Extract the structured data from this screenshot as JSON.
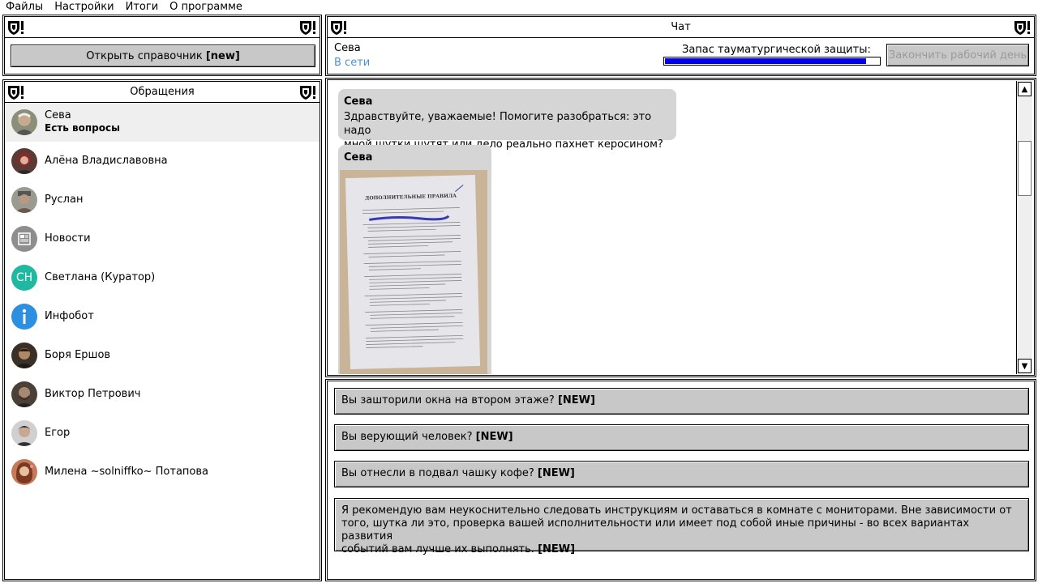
{
  "menu": [
    "Файлы",
    "Настройки",
    "Итоги",
    "О программе"
  ],
  "left_top": {
    "open_ref_label": "Открыть справочник",
    "open_ref_badge": "[new]"
  },
  "contacts_panel": {
    "title": "Обращения",
    "contacts": [
      {
        "name": "Сева",
        "status": "Есть вопросы",
        "avatar": "photo-avatar-old-man"
      },
      {
        "name": "Алёна Владиславовна",
        "status": "",
        "avatar": "photo-avatar-woman-red"
      },
      {
        "name": "Руслан",
        "status": "",
        "avatar": "photo-avatar-man-cap"
      },
      {
        "name": "Новости",
        "status": "",
        "avatar": "newspaper-icon"
      },
      {
        "name": "Светлана (Куратор)",
        "status": "",
        "avatar": "initials-СН"
      },
      {
        "name": "Инфобот",
        "status": "",
        "avatar": "info-icon"
      },
      {
        "name": "Боря Ершов",
        "status": "",
        "avatar": "photo-avatar-man-dark"
      },
      {
        "name": "Виктор Петрович",
        "status": "",
        "avatar": "photo-avatar-man-beard"
      },
      {
        "name": "Егор",
        "status": "",
        "avatar": "photo-avatar-young-man"
      },
      {
        "name": "Милена ~solniffko~ Потапова",
        "status": "",
        "avatar": "photo-avatar-girl"
      }
    ],
    "initials": "СН"
  },
  "chat": {
    "title": "Чат",
    "contact_name": "Сева",
    "contact_status": "В сети",
    "protection_label": "Запас тауматургической защиты:",
    "protection_level": 0.94,
    "end_day_label": "Закончить рабочий день",
    "messages": [
      {
        "sender": "Сева",
        "text_line1": "Здравствуйте, уважаемые! Помогите разобраться: это надо",
        "text_line2": "мной шутки шутят или дело реально пахнет керосином?"
      },
      {
        "sender": "Сева",
        "image": "document-photo",
        "doc_title": "ДОПОЛНИТЕЛЬНЫЕ ПРАВИЛА"
      }
    ]
  },
  "answers": [
    {
      "text": "Вы зашторили окна на втором этаже?",
      "badge": "[NEW]"
    },
    {
      "text": "Вы верующий человек?",
      "badge": "[NEW]"
    },
    {
      "text": "Вы отнесли в подвал чашку кофе?",
      "badge": "[NEW]"
    },
    {
      "text_line1": "Я рекомендую вам неукоснительно следовать инструкциям и оставаться в комнате с мониторами. Вне зависимости от",
      "text_line2": "того, шутка ли это, проверка вашей исполнительности или имеет под собой иные причины - во всех вариантах развития",
      "text_line3": "событий вам лучше их выполнять.",
      "badge": "[NEW]"
    }
  ],
  "colors": {
    "accent_blue": "#0000ee",
    "online": "#4a90d9",
    "button": "#c8c8c8",
    "bubble": "#d5d5d5"
  }
}
